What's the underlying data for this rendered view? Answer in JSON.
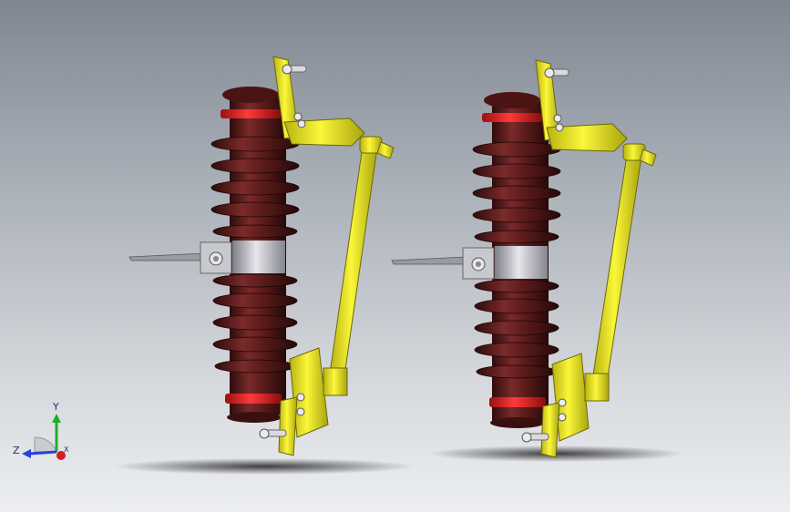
{
  "viewport": {
    "background_top": "#7f8791",
    "background_bottom": "#eceef0"
  },
  "model": {
    "insulator_color": "#5a1a1a",
    "band_color": "#d81f1f",
    "bracket_color": "#f0ec1e",
    "clamp_color": "#b9b9c0",
    "units": [
      "cutout-fuse-left",
      "cutout-fuse-right"
    ]
  },
  "triad": {
    "y_label": "Y",
    "z_label": "Z",
    "x_label": "X",
    "y_color": "#1fae2a",
    "z_color": "#2a3fd6",
    "x_color": "#d61f1f"
  }
}
